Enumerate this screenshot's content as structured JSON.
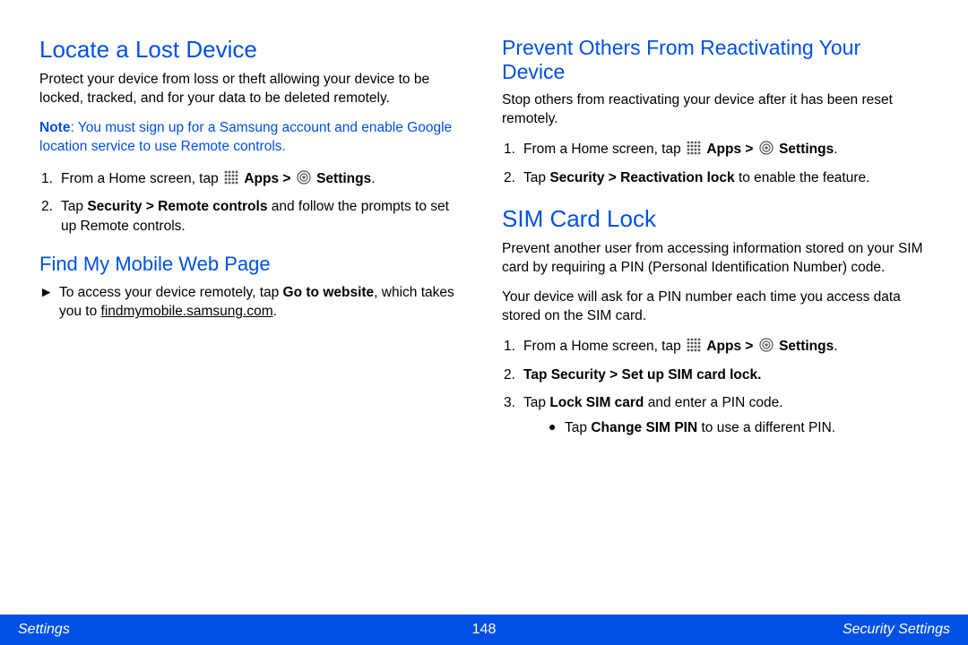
{
  "left": {
    "h1": "Locate a Lost Device",
    "intro": "Protect your device from loss or theft allowing your device to be locked, tracked, and for your data to be deleted remotely.",
    "note_label": "Note",
    "note_text": ": You must sign up for a Samsung account and enable Google location service to use Remote controls.",
    "step1_pre": "From a Home screen, tap ",
    "apps_label": "Apps > ",
    "settings_label": "Settings",
    "step1_post": ".",
    "step2_pre": "Tap ",
    "step2_bold": "Security > Remote controls",
    "step2_post": " and follow the prompts to set up Remote controls.",
    "h2": "Find My Mobile Web Page",
    "bullet_pre": "To access your device remotely, tap ",
    "bullet_bold": "Go to website",
    "bullet_mid": ", which takes you to ",
    "bullet_link": "findmymobile.samsung.com",
    "bullet_post": "."
  },
  "right": {
    "h2a": "Prevent Others From Reactivating Your Device",
    "intro_a": "Stop others from reactivating your device after it has been reset remotely.",
    "a_step1_pre": "From a Home screen, tap ",
    "a_step2_pre": "Tap ",
    "a_step2_bold": "Security > Reactivation lock",
    "a_step2_post": " to enable the feature.",
    "h1b": "SIM Card Lock",
    "intro_b1": "Prevent another user from accessing information stored on your SIM card by requiring a PIN (Personal Identification Number) code.",
    "intro_b2": "Your device will ask for a PIN number each time you access data stored on the SIM card.",
    "b_step2": "Tap Security > Set up SIM card lock.",
    "b_step3_pre": "Tap ",
    "b_step3_bold": "Lock SIM card",
    "b_step3_post": " and enter a PIN code.",
    "b_sub_pre": "Tap ",
    "b_sub_bold": "Change SIM PIN",
    "b_sub_post": " to use a different PIN."
  },
  "footer": {
    "left": "Settings",
    "center": "148",
    "right": "Security Settings"
  },
  "icons": {
    "apps": "apps-icon",
    "settings": "settings-icon"
  }
}
